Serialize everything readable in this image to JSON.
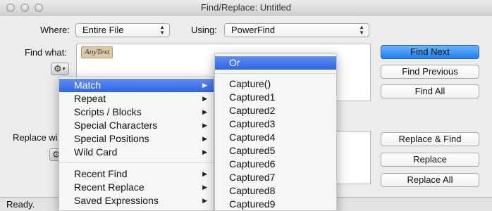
{
  "window": {
    "title": "Find/Replace: Untitled"
  },
  "where": {
    "label": "Where:",
    "value": "Entire File"
  },
  "using": {
    "label": "Using:",
    "value": "PowerFind"
  },
  "find": {
    "label": "Find what:",
    "token": "AnyText"
  },
  "replace": {
    "label": "Replace wi"
  },
  "buttons": {
    "find_next": "Find Next",
    "find_previous": "Find Previous",
    "find_all": "Find All",
    "replace_and_find": "Replace & Find",
    "replace": "Replace",
    "replace_all": "Replace All"
  },
  "status": "Ready.",
  "menu": {
    "items": [
      {
        "label": "Match",
        "submenu": true,
        "highlighted": true
      },
      {
        "label": "Repeat",
        "submenu": true
      },
      {
        "label": "Scripts / Blocks",
        "submenu": true
      },
      {
        "label": "Special Characters",
        "submenu": true
      },
      {
        "label": "Special Positions",
        "submenu": true
      },
      {
        "label": "Wild Card",
        "submenu": true
      },
      {
        "label": "Recent Find",
        "submenu": true
      },
      {
        "label": "Recent Replace",
        "submenu": true
      },
      {
        "label": "Saved Expressions",
        "submenu": true
      }
    ]
  },
  "submenu": {
    "items": [
      {
        "label": "Or",
        "highlighted": true
      },
      {
        "label": "Capture()"
      },
      {
        "label": "Captured1"
      },
      {
        "label": "Captured2"
      },
      {
        "label": "Captured3"
      },
      {
        "label": "Captured4"
      },
      {
        "label": "Captured5"
      },
      {
        "label": "Captured6"
      },
      {
        "label": "Captured7"
      },
      {
        "label": "Captured8"
      },
      {
        "label": "Captured9"
      }
    ]
  },
  "icons": {
    "gear": "gear-icon",
    "submenu_arrow": "submenu-arrow-icon",
    "popup_arrows": "updown-arrows-icon"
  },
  "colors": {
    "accent": "#2f64e6",
    "default_button": "#1f7ef2",
    "token_bg": "#dbc8a8"
  }
}
